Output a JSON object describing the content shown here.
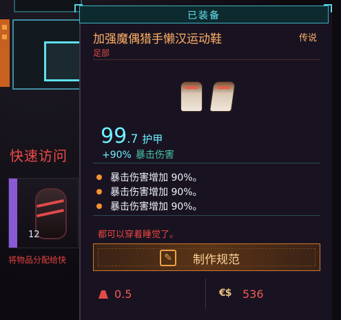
{
  "tooltip": {
    "header": "已装备",
    "item_name": "加强魔偶猎手懒汉运动鞋",
    "rarity": "传说",
    "slot_type": "足部",
    "armor_int": "99",
    "armor_dec": ".7",
    "armor_label": "护甲",
    "crit_value": "+90%",
    "crit_label": "暴击伤害",
    "effects": [
      "暴击伤害增加 90%。",
      "暴击伤害增加 90%。",
      "暴击伤害增加 90%。"
    ],
    "flavor": "都可以穿着睡觉了。",
    "craft_label": "制作规范",
    "weight": "0.5",
    "money_icon": "€$",
    "price": "536"
  },
  "background": {
    "quick_access": "快速访问",
    "grenade_count": "12",
    "assign_text": "将物品分配给快"
  },
  "colors": {
    "accent_teal": "#65e6f1",
    "accent_orange": "#ffb066",
    "accent_red": "#e8453f",
    "panel_bg": "#191321"
  }
}
